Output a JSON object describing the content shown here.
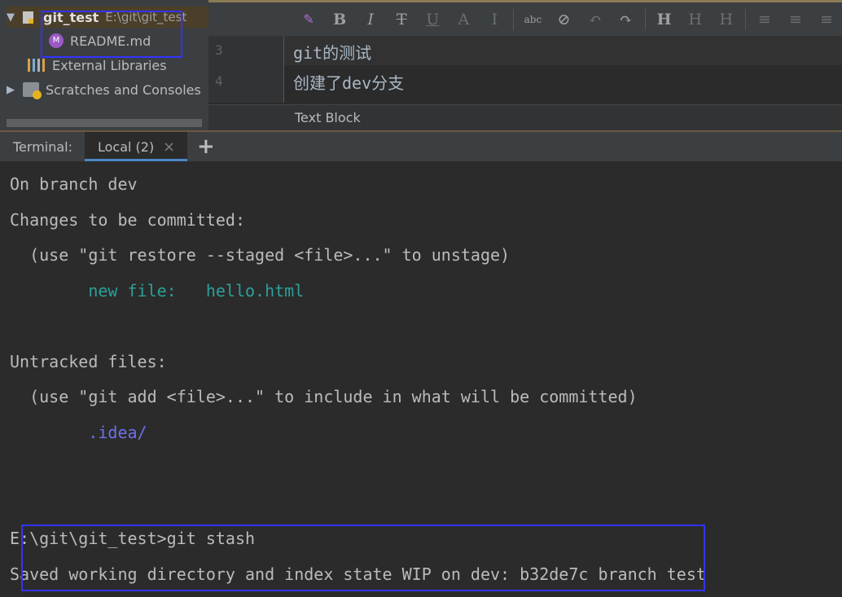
{
  "project": {
    "root_name": "git_test",
    "root_path": "E:\\git\\git_test",
    "readme": "README.md",
    "external_libraries": "External Libraries",
    "scratches": "Scratches and Consoles"
  },
  "editor": {
    "toolbar": [
      "B",
      "I",
      "T",
      "U",
      "A",
      "I",
      "abc",
      "⊘",
      "↶",
      "↷",
      "H",
      "H",
      "H",
      "≡",
      "≡",
      "≡"
    ],
    "lines": [
      {
        "number": "3",
        "text": "git的测试"
      },
      {
        "number": "4",
        "text": "创建了dev分支"
      }
    ],
    "breadcrumb": "Text Block"
  },
  "terminal": {
    "label": "Terminal:",
    "tab": "Local (2)",
    "close_icon": "×",
    "add_icon": "+",
    "lines": {
      "l1": "On branch dev",
      "l2": "Changes to be committed:",
      "l3": "  (use \"git restore --staged <file>...\" to unstage)",
      "l4": "        new file:   hello.html",
      "l5": "Untracked files:",
      "l6": "  (use \"git add <file>...\" to include in what will be committed)",
      "l7": "        .idea/",
      "l8": "E:\\git\\git_test>git stash",
      "l9": "Saved working directory and index state WIP on dev: b32de7c branch test"
    }
  },
  "colors": {
    "accent_box": "#3333ff",
    "green": "#2aa198",
    "blue_path": "#6c71e8"
  }
}
